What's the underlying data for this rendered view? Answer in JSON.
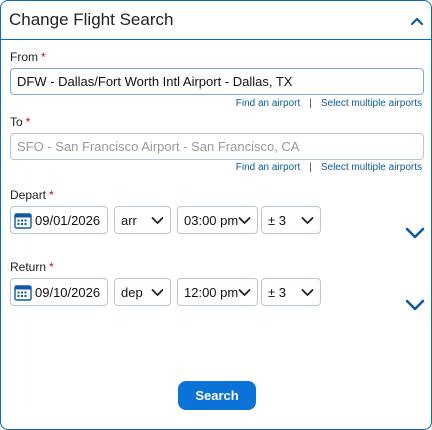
{
  "header": {
    "title": "Change Flight Search",
    "collapse_icon": "chevron-up-icon"
  },
  "from": {
    "label": "From",
    "required": "*",
    "value": "DFW - Dallas/Fort Worth Intl Airport - Dallas, TX",
    "find_link": "Find an airport",
    "multi_link": "Select multiple airports",
    "separator": "|"
  },
  "to": {
    "label": "To",
    "required": "*",
    "placeholder": "SFO - San Francisco Airport - San Francisco, CA",
    "find_link": "Find an airport",
    "multi_link": "Select multiple airports",
    "separator": "|"
  },
  "depart": {
    "label": "Depart",
    "required": "*",
    "date": "09/01/2026",
    "arr_dep": "arr",
    "time": "03:00 pm",
    "window": "± 3",
    "expand_icon": "chevron-down-icon"
  },
  "return": {
    "label": "Return",
    "required": "*",
    "date": "09/10/2026",
    "arr_dep": "dep",
    "time": "12:00 pm",
    "window": "± 3",
    "expand_icon": "chevron-down-icon"
  },
  "search_button": "Search",
  "colors": {
    "accent": "#0b73d8",
    "border": "#0c6bbd",
    "required": "#d0021b",
    "link": "#0c5aa6"
  }
}
